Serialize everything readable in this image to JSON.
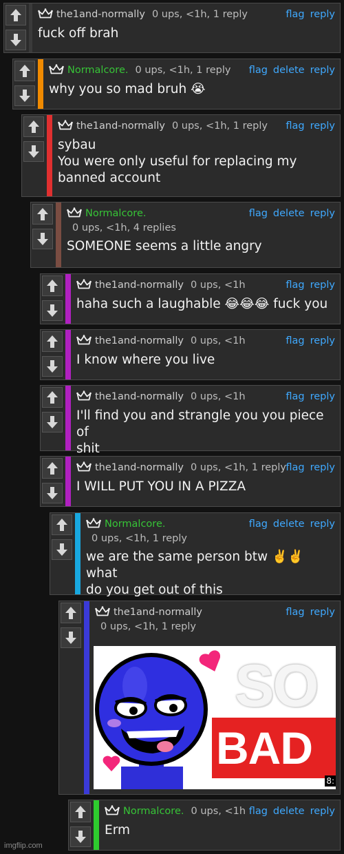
{
  "actions": {
    "flag": "flag",
    "delete": "delete",
    "reply": "reply"
  },
  "comments": [
    {
      "user": "the1and-normally",
      "stats": "0 ups, <1h, 1 reply",
      "text": "fuck off brah"
    },
    {
      "user": "Normalcore.",
      "stats": "0 ups, <1h, 1 reply",
      "text": "why you so mad bruh 😭"
    },
    {
      "user": "the1and-normally",
      "stats": "0 ups, <1h, 1 reply",
      "text": "sybau\nYou were only useful for replacing my\nbanned account"
    },
    {
      "user": "Normalcore.",
      "stats": "0 ups, <1h, 4 replies",
      "text": "SOMEONE seems a little angry"
    },
    {
      "user": "the1and-normally",
      "stats": "0 ups, <1h",
      "text": "haha such a laughable 😂😂😂 fuck you"
    },
    {
      "user": "the1and-normally",
      "stats": "0 ups, <1h",
      "text": "I know where you live"
    },
    {
      "user": "the1and-normally",
      "stats": "0 ups, <1h",
      "text": "I'll find you and strangle you you piece of\nshit"
    },
    {
      "user": "the1and-normally",
      "stats": "0 ups, <1h, 1 reply",
      "text": "I WILL PUT YOU IN A PIZZA"
    },
    {
      "user": "Normalcore.",
      "stats": "0 ups, <1h, 1 reply",
      "text": "we are the same person btw ✌️✌️ what\ndo you get out of this"
    },
    {
      "user": "the1and-normally",
      "stats": "0 ups, <1h, 1 reply",
      "text": ""
    },
    {
      "user": "Normalcore.",
      "stats": "0 ups, <1h",
      "text": "Erm"
    }
  ],
  "meme": {
    "top_word": "SO",
    "bottom_word": "BAD",
    "timestamp": "8:",
    "caption_icon": "heart-icon"
  },
  "colors": {
    "reply_border_1": "#f08a00",
    "reply_border_2": "#e03030",
    "reply_border_3": "#7a4d42",
    "reply_border_4": "#b020c0",
    "reply_border_5": "#18a8e0",
    "reply_border_6": "#3a3ad8",
    "reply_border_7": "#2ecc2e",
    "link": "#3fa9ff",
    "username_green": "#37c437"
  },
  "watermark": "imgflip.com"
}
